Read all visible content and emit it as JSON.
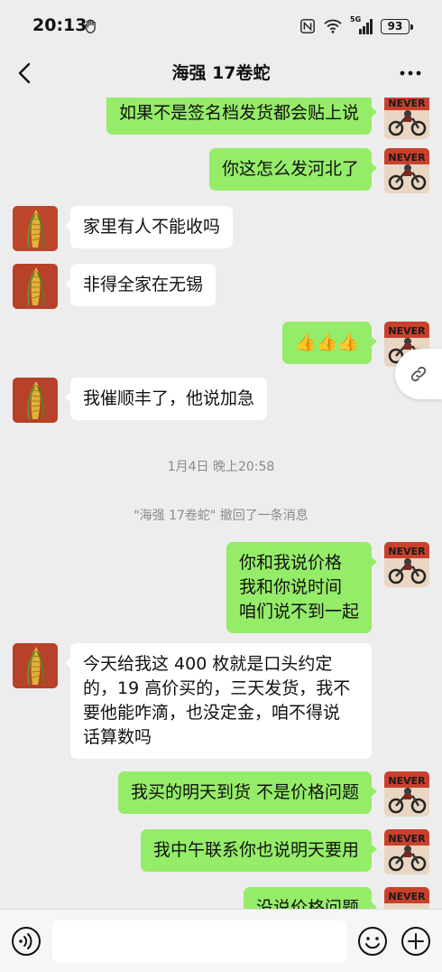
{
  "status_bar": {
    "time": "20:13",
    "network": "5G",
    "battery": "93"
  },
  "header": {
    "title": "海强 17卷蛇"
  },
  "messages": [
    {
      "side": "me",
      "lines": [
        "如果不是签名档发货都会贴上说"
      ]
    },
    {
      "side": "me",
      "lines": [
        "你这怎么发河北了"
      ]
    },
    {
      "side": "other",
      "lines": [
        "家里有人不能收吗"
      ]
    },
    {
      "side": "other",
      "lines": [
        "非得全家在无锡"
      ]
    },
    {
      "side": "me",
      "lines": [
        "👍👍👍"
      ]
    },
    {
      "side": "other",
      "lines": [
        "我催顺丰了，他说加急"
      ]
    },
    {
      "side": "me",
      "lines": [
        "你和我说价格",
        "我和你说时间",
        "咱们说不到一起"
      ]
    },
    {
      "side": "other",
      "lines": [
        "今天给我这 400 枚就是口头约定",
        "的，19 高价买的，三天发货，我不",
        "要他能咋滴，也没定金，咱不得说",
        "话算数吗"
      ]
    },
    {
      "side": "me",
      "lines": [
        "我买的明天到货 不是价格问题"
      ]
    },
    {
      "side": "me",
      "lines": [
        "我中午联系你也说明天要用"
      ]
    },
    {
      "side": "me",
      "lines": [
        "没说价格问题"
      ]
    }
  ],
  "system": {
    "timestamp": "1月4日 晚上20:58",
    "recall_notice": "\"海强 17卷蛇\" 撤回了一条消息"
  },
  "avatar_me": {
    "text": "NEVER GIVE UP",
    "color": "#c0392b"
  },
  "avatar_other": {
    "color": "#b8412a"
  },
  "input": {
    "value": ""
  },
  "colors": {
    "my_bubble": "#95ec69",
    "their_bubble": "#ffffff",
    "background": "#ededed"
  }
}
